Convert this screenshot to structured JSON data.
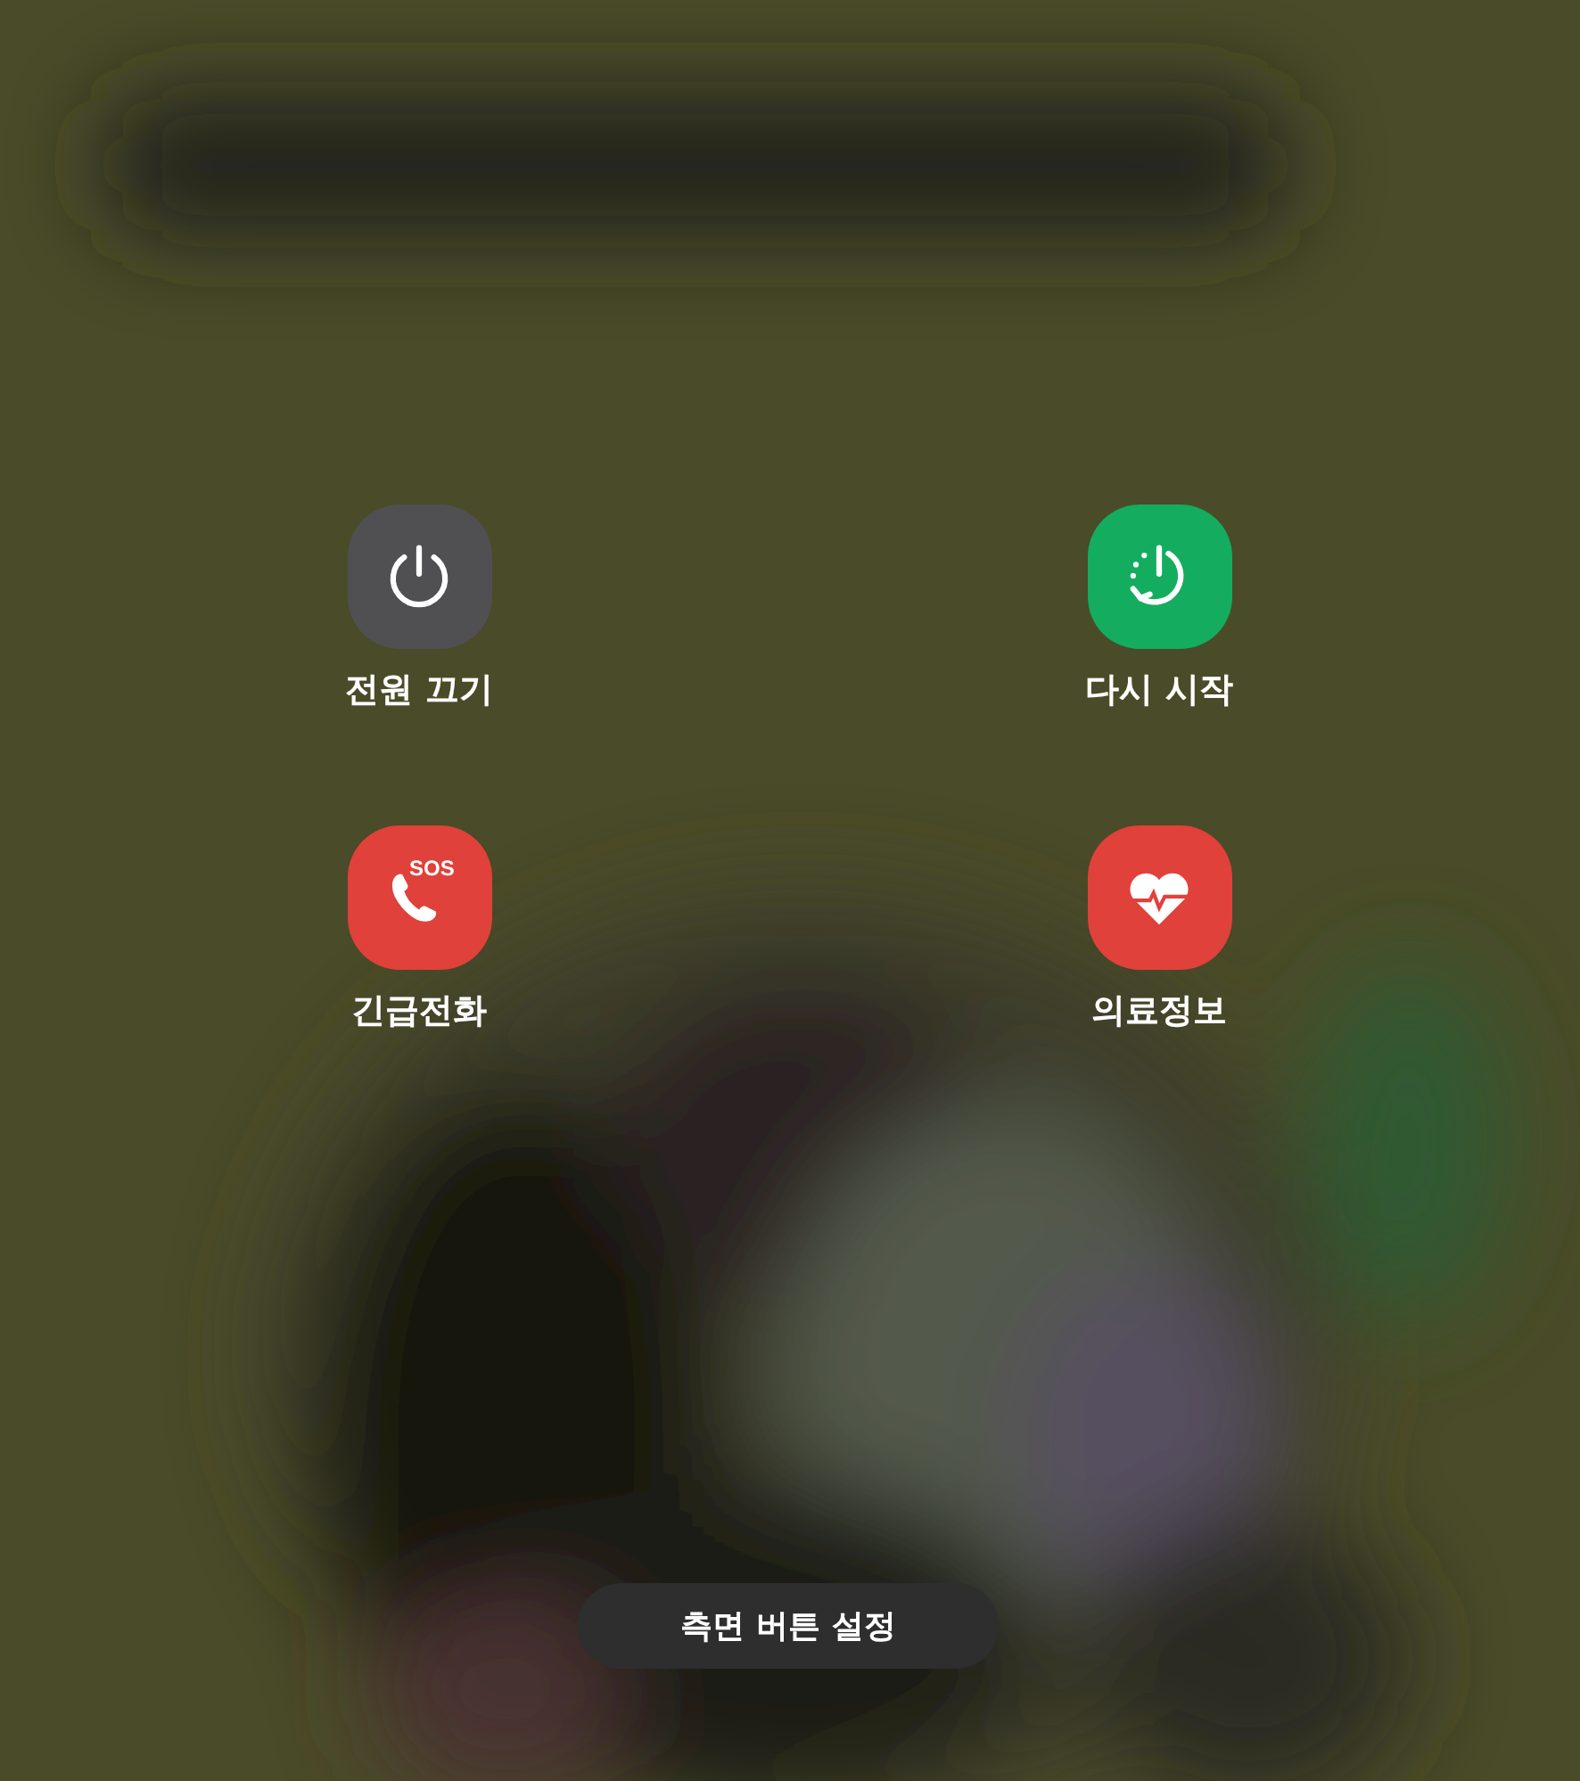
{
  "actions": [
    {
      "kind": "power",
      "label": "전원 끄기",
      "color": "#505053"
    },
    {
      "kind": "restart",
      "label": "다시 시작",
      "color": "#14ad5f"
    },
    {
      "kind": "emergency",
      "label": "긴급전화",
      "color": "#e0413a",
      "badge": "SOS"
    },
    {
      "kind": "medical",
      "label": "의료정보",
      "color": "#e0413a"
    }
  ],
  "bottom_button": {
    "label": "측면 버튼 설정"
  }
}
